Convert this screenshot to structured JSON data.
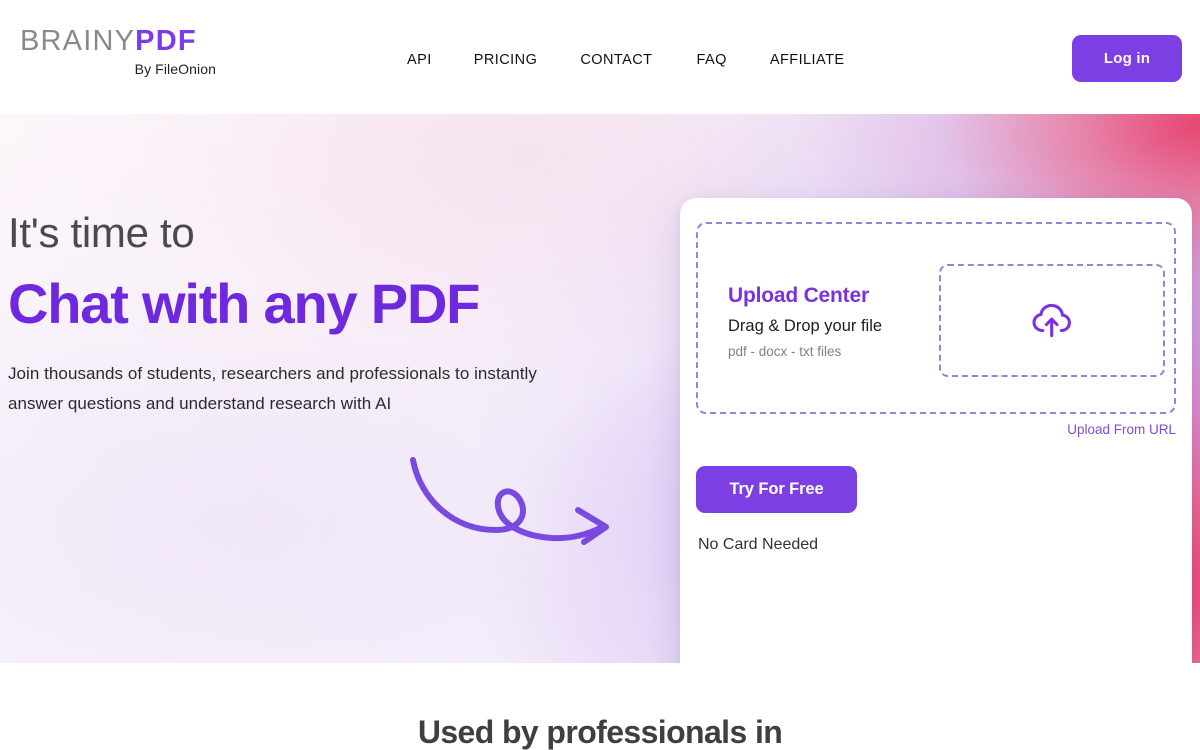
{
  "brand": {
    "name_grey": "BRAINY",
    "name_accent": "PDF",
    "tagline": "By FileOnion"
  },
  "header": {
    "nav": [
      {
        "label": "API"
      },
      {
        "label": "PRICING"
      },
      {
        "label": "CONTACT"
      },
      {
        "label": "FAQ"
      },
      {
        "label": "AFFILIATE"
      }
    ],
    "login_label": "Log in"
  },
  "hero": {
    "headline_top": "It's time to",
    "headline_main": "Chat with any PDF",
    "subcopy": "Join thousands of students, researchers and professionals to instantly answer questions and understand research with AI",
    "arrow_icon": "curved-arrow-icon"
  },
  "upload_card": {
    "dropzone": {
      "title": "Upload Center",
      "subtitle": "Drag & Drop your file",
      "formats": "pdf - docx - txt files",
      "icon": "cloud-upload-icon"
    },
    "upload_from_url_label": "Upload From URL",
    "cta_label": "Try For Free",
    "note": "No Card Needed"
  },
  "bottom": {
    "heading": "Used by professionals in"
  },
  "colors": {
    "accent_purple": "#7b3fe4",
    "heading_purple": "#6d28e0",
    "dropzone_title_purple": "#7a31e0",
    "link_purple": "#7c4ddb",
    "dashed_border": "#9b7fdc",
    "brand_grey": "#8a8a8a",
    "gradient_left": "#fdf7fb",
    "gradient_mid": "#efe9fa",
    "gradient_right": "#ec3e6e"
  }
}
